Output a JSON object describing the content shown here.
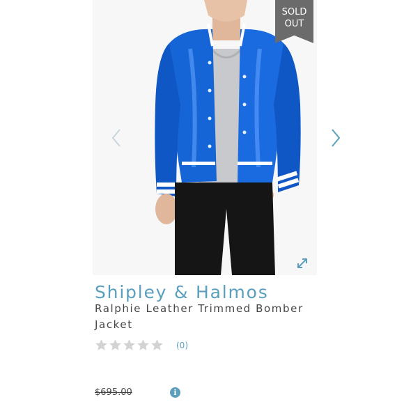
{
  "product": {
    "badge_line1": "SOLD",
    "badge_line2": "OUT",
    "brand": "Shipley & Halmos",
    "title": "Ralphie Leather Trimmed Bomber Jacket",
    "rating_stars_filled": 0,
    "rating_stars_total": 5,
    "review_count": "(0)",
    "price": "$695.00",
    "info_icon_glyph": "i"
  },
  "icons": {
    "prev": "chevron-left-icon",
    "next": "chevron-right-icon",
    "expand": "expand-icon",
    "star": "star-icon",
    "info": "info-icon"
  },
  "colors": {
    "accent": "#5b9fbd",
    "badge": "#6b6b6b",
    "star_empty": "#d3d3d3",
    "jacket": "#1565d6"
  }
}
